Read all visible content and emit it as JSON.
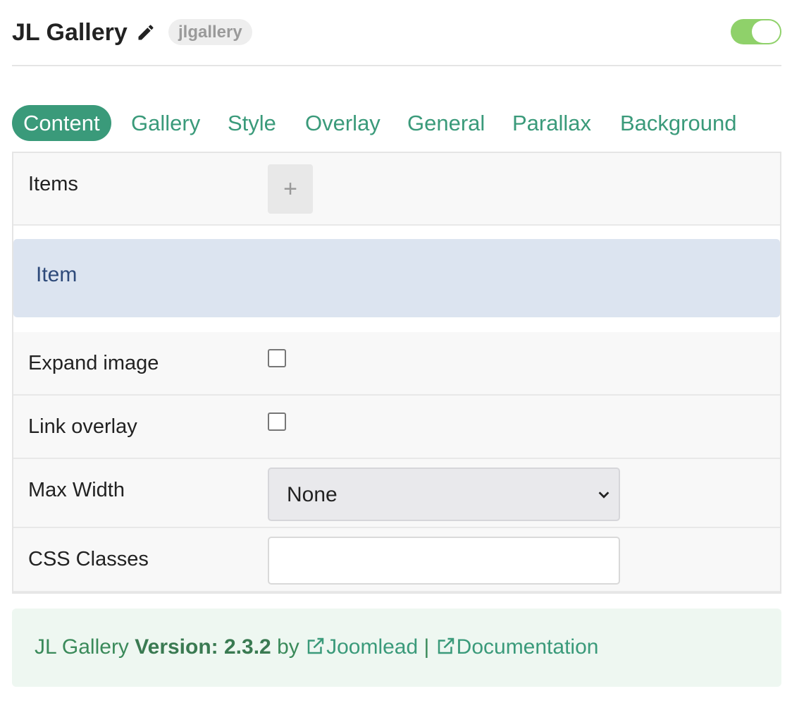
{
  "header": {
    "title": "JL Gallery",
    "slug": "jlgallery",
    "enabled": true,
    "accent_color": "#8fd16a"
  },
  "tabs": [
    {
      "label": "Content",
      "active": true
    },
    {
      "label": "Gallery",
      "active": false
    },
    {
      "label": "Style",
      "active": false
    },
    {
      "label": "Overlay",
      "active": false
    },
    {
      "label": "General",
      "active": false
    },
    {
      "label": "Parallax",
      "active": false
    },
    {
      "label": "Background",
      "active": false
    }
  ],
  "content": {
    "items_label": "Items",
    "add_icon": "plus-icon",
    "item_card_title": "Item",
    "expand_image_label": "Expand image",
    "expand_image_checked": false,
    "link_overlay_label": "Link overlay",
    "link_overlay_checked": false,
    "max_width_label": "Max Width",
    "max_width_value": "None",
    "css_classes_label": "CSS Classes",
    "css_classes_value": ""
  },
  "footer": {
    "name": "JL Gallery",
    "version_label": "Version: 2.3.2",
    "by": "by",
    "author_link": "Joomlead",
    "separator": "|",
    "docs_link": "Documentation"
  },
  "colors": {
    "primary": "#3a9a7a",
    "item_card_bg": "#dce4f0",
    "footer_bg": "#eef7f1"
  }
}
